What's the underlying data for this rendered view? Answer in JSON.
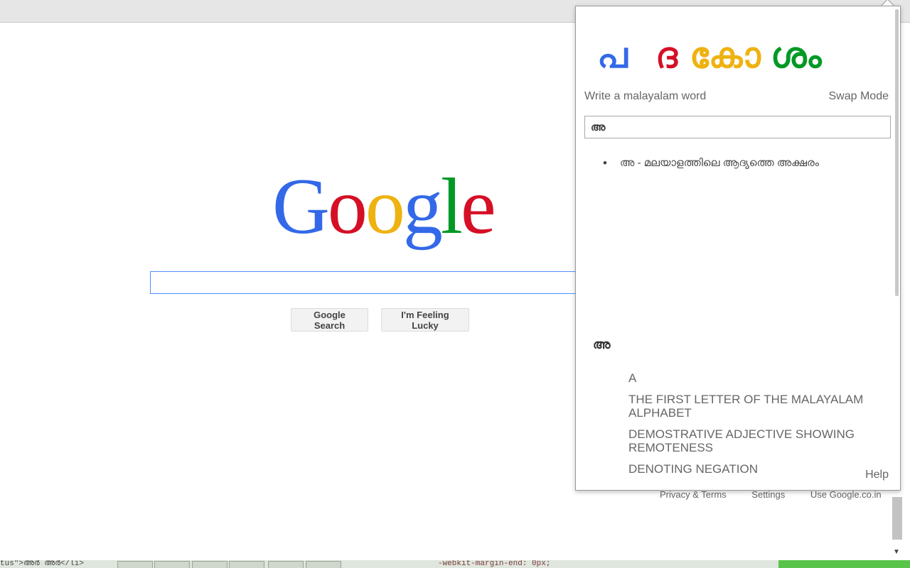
{
  "google": {
    "logo_letters": [
      {
        "ch": "G",
        "color": "#3369e8"
      },
      {
        "ch": "o",
        "color": "#d50f25"
      },
      {
        "ch": "o",
        "color": "#eeb211"
      },
      {
        "ch": "g",
        "color": "#3369e8"
      },
      {
        "ch": "l",
        "color": "#009925"
      },
      {
        "ch": "e",
        "color": "#d50f25"
      }
    ],
    "search_value": "",
    "search_button": "Google Search",
    "lucky_button": "I'm Feeling Lucky",
    "footer": [
      "Privacy & Terms",
      "Settings",
      "Use Google.co.in"
    ]
  },
  "popup": {
    "logo_chars": [
      {
        "ch": "പ",
        "color": "#3369e8"
      },
      {
        "ch": "ദ",
        "color": "#d50f25"
      },
      {
        "ch": "കോ",
        "color": "#eeb211"
      },
      {
        "ch": "ശം",
        "color": "#009925"
      }
    ],
    "write_label": "Write a malayalam word",
    "swap_mode": "Swap Mode",
    "input_value": "അ",
    "suggestions": [
      "അ - മലയാളത്തിലെ ആദ്യത്തെ അക്ഷരം"
    ],
    "headword": "അ",
    "meanings": [
      "A",
      "THE FIRST LETTER OF THE MALAYALAM ALPHABET",
      "DEMOSTRATIVE ADJECTIVE SHOWING REMOTENESS",
      "DENOTING NEGATION"
    ],
    "help": "Help"
  },
  "taskbar": {
    "left_code": "tus\">അർ അർ</li>",
    "right_code": "-webkit-margin-end: 0px;"
  }
}
